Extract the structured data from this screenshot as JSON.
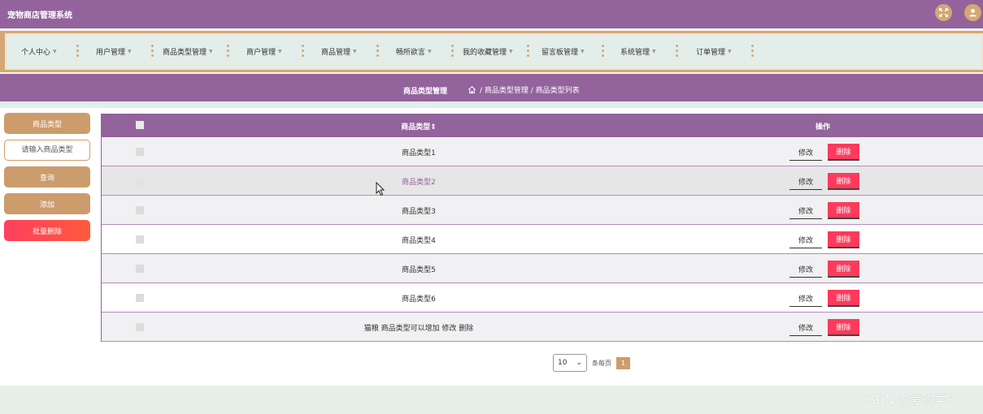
{
  "app": {
    "title": "宠物商店管理系统"
  },
  "header_icons": [
    "fullscreen-icon",
    "user-icon"
  ],
  "nav": {
    "items": [
      {
        "label": "个人中心"
      },
      {
        "label": "用户管理"
      },
      {
        "label": "商品类型管理"
      },
      {
        "label": "商户管理"
      },
      {
        "label": "商品管理"
      },
      {
        "label": "畅所欲言"
      },
      {
        "label": "我的收藏管理"
      },
      {
        "label": "留言板管理"
      },
      {
        "label": "系统管理"
      },
      {
        "label": "订单管理"
      }
    ]
  },
  "breadcrumb": {
    "title": "商品类型管理",
    "path": "/ 商品类型管理 / 商品类型列表"
  },
  "sidebar": {
    "label_button": "商品类型",
    "search_placeholder": "请输入商品类型",
    "query_button": "查询",
    "add_button": "添加",
    "batch_delete_button": "批量删除"
  },
  "table": {
    "col_name": "商品类型",
    "col_sort": "⇕",
    "col_ops": "操作",
    "edit_label": "修改",
    "delete_label": "删除",
    "rows": [
      {
        "name": "商品类型1"
      },
      {
        "name": "商品类型2"
      },
      {
        "name": "商品类型3"
      },
      {
        "name": "商品类型4"
      },
      {
        "name": "商品类型5"
      },
      {
        "name": "商品类型6"
      },
      {
        "name": "猫粮 商品类型可以增加 修改 删除"
      }
    ]
  },
  "pagination": {
    "page_size": "10",
    "per_page_label": "条每页",
    "current_page": "1"
  },
  "watermark": "CSDN @爱得学长",
  "colors": {
    "primary": "#93639b",
    "accent": "#cc9c6c",
    "danger": "#ff3a5c",
    "nav_bg": "#e3ede9"
  }
}
